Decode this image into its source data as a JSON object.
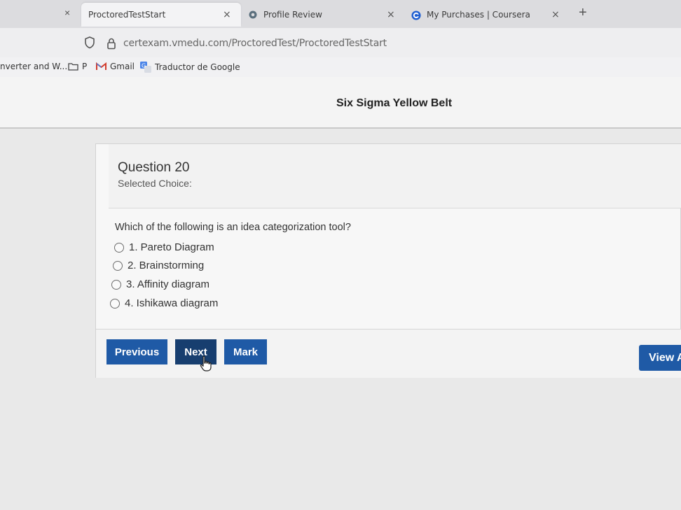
{
  "browser": {
    "tabs": [
      {
        "label": "ProctoredTestStart",
        "active": true
      },
      {
        "label": "Profile Review",
        "active": false,
        "icon": "profile-favicon"
      },
      {
        "label": "My Purchases | Coursera",
        "active": false,
        "icon": "coursera-icon"
      }
    ],
    "close_glyph": "×",
    "new_tab_glyph": "+",
    "url": "certexam.vmedu.com/ProctoredTest/ProctoredTestStart",
    "bookmarks": [
      {
        "label": "nverter and W..."
      },
      {
        "label": "P",
        "icon": "folder-icon"
      },
      {
        "label": "Gmail",
        "icon": "gmail-icon"
      },
      {
        "label": "Traductor de Google",
        "icon": "google-translate-icon"
      }
    ]
  },
  "page": {
    "exam_title": "Six Sigma Yellow Belt",
    "question": {
      "title": "Question 20",
      "selected_choice_label": "Selected Choice:",
      "text": "Which of the following is an idea categorization tool?",
      "options": [
        {
          "label": "1. Pareto Diagram"
        },
        {
          "label": "2. Brainstorming"
        },
        {
          "label": "3. Affinity diagram"
        },
        {
          "label": "4. Ishikawa diagram"
        }
      ]
    },
    "buttons": {
      "previous": "Previous",
      "next": "Next",
      "mark": "Mark",
      "view_all": "View A"
    },
    "colors": {
      "primary_button": "#1f5aa6",
      "hover_button": "#173e6f"
    }
  }
}
